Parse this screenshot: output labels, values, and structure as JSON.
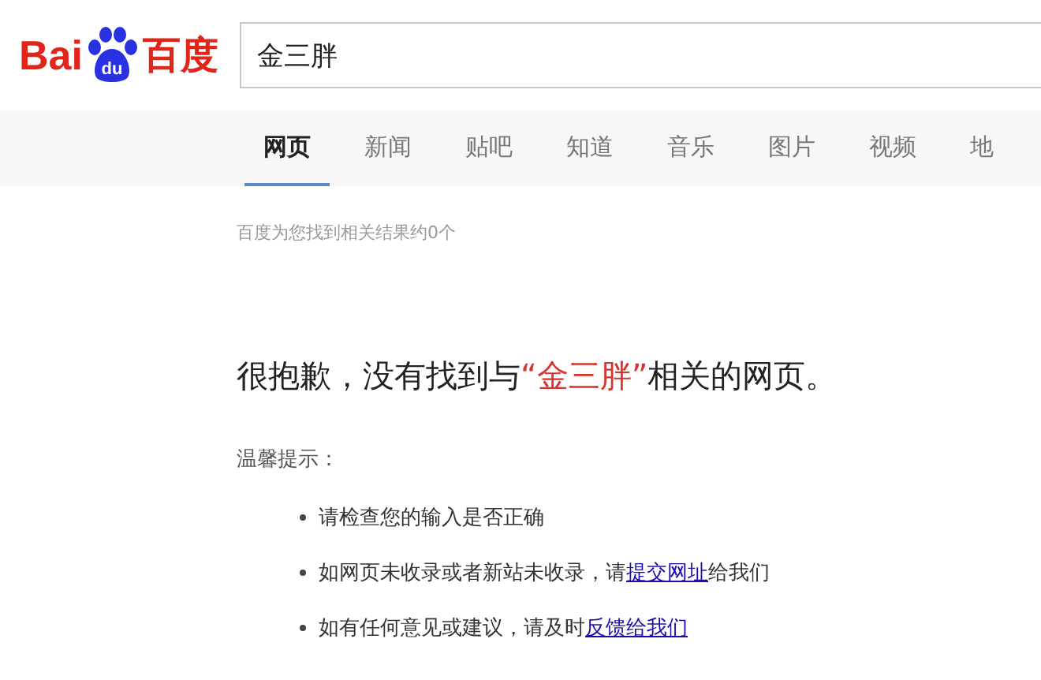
{
  "logo": {
    "left": "Bai",
    "paw": "du",
    "right": "百度"
  },
  "search": {
    "value": "金三胖"
  },
  "tabs": [
    {
      "label": "网页",
      "selected": true
    },
    {
      "label": "新闻",
      "selected": false
    },
    {
      "label": "贴吧",
      "selected": false
    },
    {
      "label": "知道",
      "selected": false
    },
    {
      "label": "音乐",
      "selected": false
    },
    {
      "label": "图片",
      "selected": false
    },
    {
      "label": "视频",
      "selected": false
    },
    {
      "label": "地",
      "selected": false
    }
  ],
  "result_count": "百度为您找到相关结果约0个",
  "headline": {
    "before": "很抱歉，没有找到与",
    "query": "“金三胖”",
    "after": "相关的网页。"
  },
  "tips_title": "温馨提示：",
  "tips": [
    {
      "text": "请检查您的输入是否正确"
    },
    {
      "text": "如网页未收录或者新站未收录，请",
      "link": "提交网址",
      "after": "给我们"
    },
    {
      "text": "如有任何意见或建议，请及时",
      "link": "反馈给我们"
    }
  ]
}
